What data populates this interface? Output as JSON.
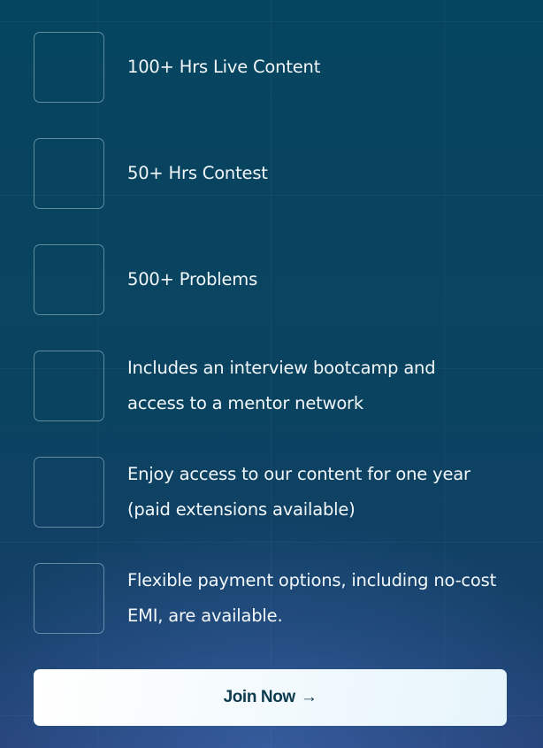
{
  "features": [
    {
      "text": "100+ Hrs Live Content"
    },
    {
      "text": "50+ Hrs Contest"
    },
    {
      "text": "500+ Problems"
    },
    {
      "text": "Includes an interview bootcamp and access to a mentor network"
    },
    {
      "text": "Enjoy access to our content for one year (paid extensions available)"
    },
    {
      "text": "Flexible payment options, including no-cost EMI, are available."
    }
  ],
  "cta": {
    "label": "Join Now",
    "icon": "arrow-right-icon"
  },
  "colors": {
    "background": "#074560",
    "button_text": "#0c3a4e"
  }
}
